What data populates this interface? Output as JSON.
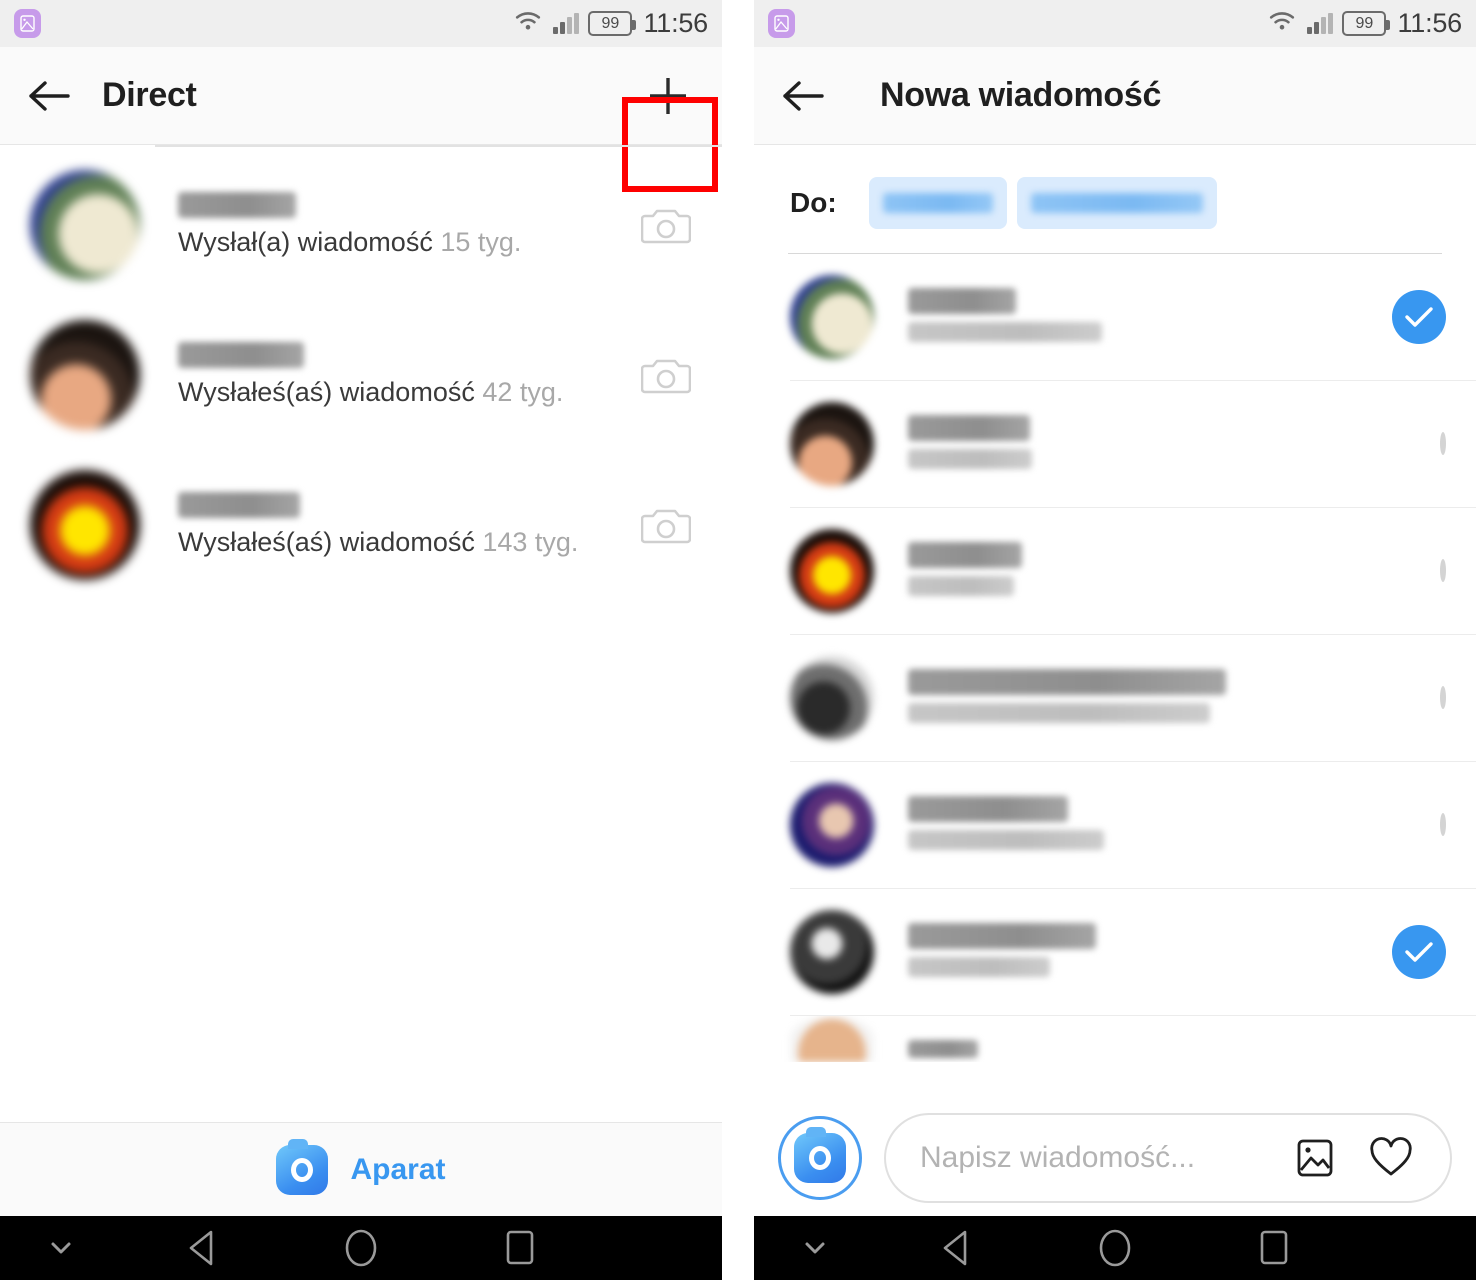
{
  "status_bar": {
    "notification_icon": "gallery-icon",
    "wifi_icon": "wifi-icon",
    "signal_icon": "cellular-signal-icon",
    "battery_level": "99",
    "time": "11:56"
  },
  "colors": {
    "accent_blue": "#3897f0",
    "highlight_red": "#fe0000",
    "chip_blue": "#daebfd",
    "status_bar_bg": "#efefef",
    "app_bar_bg": "#fafafa"
  },
  "left_screen": {
    "header": {
      "back_icon": "back-arrow-icon",
      "title": "Direct",
      "new_message_icon": "plus-icon",
      "highlight": "red-box-around-plus"
    },
    "threads": [
      {
        "name_redacted": true,
        "name_width": 118,
        "preview": "Wysłał(a) wiadomość",
        "time": "15 tyg.",
        "action_icon": "camera-icon"
      },
      {
        "name_redacted": true,
        "name_width": 126,
        "preview": "Wysłałeś(aś) wiadomość",
        "time": "42 tyg.",
        "action_icon": "camera-icon"
      },
      {
        "name_redacted": true,
        "name_width": 122,
        "preview": "Wysłałeś(aś) wiadomość",
        "time": "143 tyg.",
        "action_icon": "camera-icon"
      }
    ],
    "camera_bar": {
      "icon": "instagram-camera-icon",
      "label": "Aparat"
    }
  },
  "right_screen": {
    "header": {
      "back_icon": "back-arrow-icon",
      "title": "Nowa wiadomość"
    },
    "to_field": {
      "label": "Do:",
      "chips": [
        {
          "redacted": true,
          "width": 110
        },
        {
          "redacted": true,
          "width": 172
        }
      ]
    },
    "users": [
      {
        "username_redacted": true,
        "username_width": 108,
        "fullname_redacted": true,
        "fullname_width": 194,
        "selected": true
      },
      {
        "username_redacted": true,
        "username_width": 122,
        "fullname_redacted": true,
        "fullname_width": 124,
        "selected": false
      },
      {
        "username_redacted": true,
        "username_width": 114,
        "fullname_redacted": true,
        "fullname_width": 106,
        "selected": false
      },
      {
        "username_redacted": true,
        "username_width": 318,
        "fullname_redacted": true,
        "fullname_width": 302,
        "selected": false
      },
      {
        "username_redacted": true,
        "username_width": 160,
        "fullname_redacted": true,
        "fullname_width": 196,
        "selected": false
      },
      {
        "username_redacted": true,
        "username_width": 188,
        "fullname_redacted": true,
        "fullname_width": 142,
        "selected": true
      }
    ],
    "composer": {
      "camera_icon": "instagram-camera-icon",
      "placeholder": "Napisz wiadomość...",
      "gallery_icon": "image-icon",
      "like_icon": "heart-icon"
    }
  },
  "nav_bar": {
    "hide_icon": "chevron-down-icon",
    "back_icon": "triangle-back-icon",
    "home_icon": "circle-home-icon",
    "recents_icon": "square-recents-icon"
  }
}
